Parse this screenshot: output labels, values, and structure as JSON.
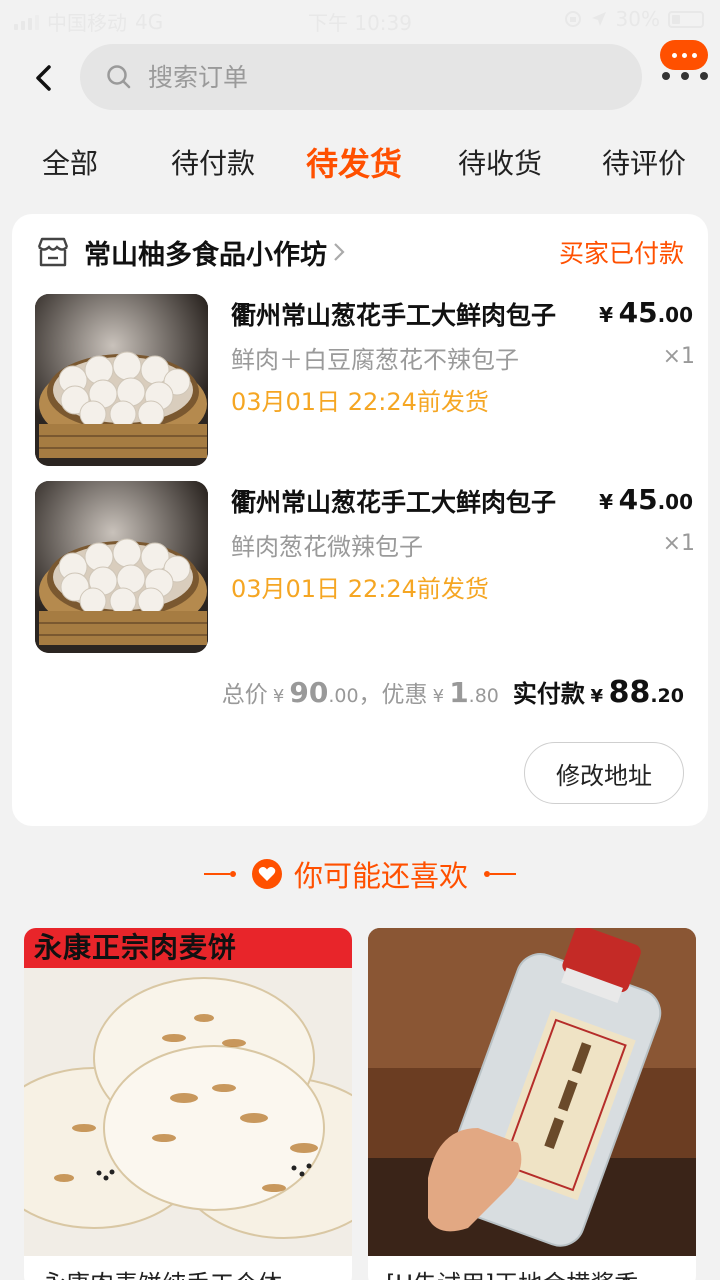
{
  "status_bar": {
    "carrier": "中国移动",
    "network": "4G",
    "time": "下午 10:39",
    "battery": "30%",
    "battery_level": 0.3
  },
  "search": {
    "placeholder": "搜索订单"
  },
  "tabs": [
    {
      "label": "全部",
      "active": false
    },
    {
      "label": "待付款",
      "active": false
    },
    {
      "label": "待发货",
      "active": true
    },
    {
      "label": "待收货",
      "active": false
    },
    {
      "label": "待评价",
      "active": false
    }
  ],
  "order": {
    "shop_name": "常山柚多食品小作坊",
    "status": "买家已付款",
    "items": [
      {
        "title": "衢州常山葱花手工大鲜肉包子",
        "price_symbol": "¥",
        "price_int": "45",
        "price_dec": ".00",
        "sku": "鲜肉＋白豆腐葱花不辣包子",
        "qty": "×1",
        "ship": "03月01日 22:24前发货"
      },
      {
        "title": "衢州常山葱花手工大鲜肉包子",
        "price_symbol": "¥",
        "price_int": "45",
        "price_dec": ".00",
        "sku": "鲜肉葱花微辣包子",
        "qty": "×1",
        "ship": "03月01日 22:24前发货"
      }
    ],
    "summary": {
      "total_label": "总价",
      "total_int": "90",
      "total_dec": ".00",
      "discount_label": "，优惠",
      "discount_int": "1",
      "discount_dec": ".80",
      "paid_label": "实付款",
      "paid_int": "88",
      "paid_dec": ".20",
      "currency": "¥"
    },
    "modify_address_label": "修改地址"
  },
  "recommend": {
    "title": "你可能还喜欢",
    "items": [
      {
        "banner": "永康正宗肉麦饼",
        "title": "永康肉麦饼纯手工个体"
      },
      {
        "title": "[U先试用]王地会横酱香"
      }
    ]
  },
  "colors": {
    "accent": "#ff5000",
    "ship": "#f5a623",
    "muted": "#9a9a9a"
  },
  "icons": [
    "signal-icon",
    "location-arrow-icon",
    "battery-icon",
    "back-arrow-icon",
    "search-icon",
    "more-menu-icon",
    "shop-icon",
    "chevron-right-icon",
    "heart-icon"
  ]
}
